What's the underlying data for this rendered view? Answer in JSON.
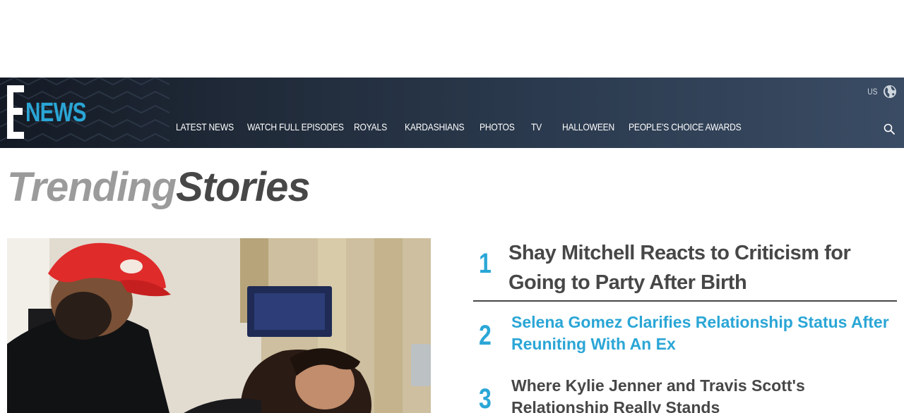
{
  "brand": {
    "logo_letter": "E",
    "logo_word": "NEWS",
    "accent_color": "#2aa6d6"
  },
  "nav": {
    "items": [
      {
        "label": "LATEST NEWS"
      },
      {
        "label": "WATCH FULL EPISODES"
      },
      {
        "label": "ROYALS"
      },
      {
        "label": "KARDASHIANS"
      },
      {
        "label": "PHOTOS"
      },
      {
        "label": "TV"
      },
      {
        "label": "HALLOWEEN"
      },
      {
        "label": "PEOPLE'S CHOICE AWARDS"
      }
    ],
    "region_label": "US",
    "region_icon": "globe-icon",
    "search_icon": "search-icon"
  },
  "trending": {
    "heading_light": "Trending",
    "heading_dark": "Stories",
    "stories": [
      {
        "rank": "1",
        "title": "Shay Mitchell Reacts to Criticism for Going to Party After Birth"
      },
      {
        "rank": "2",
        "title": "Selena Gomez Clarifies Relationship Status After Reuniting With An Ex"
      },
      {
        "rank": "3",
        "title": "Where Kylie Jenner and Travis Scott's Relationship Really Stands"
      }
    ]
  }
}
